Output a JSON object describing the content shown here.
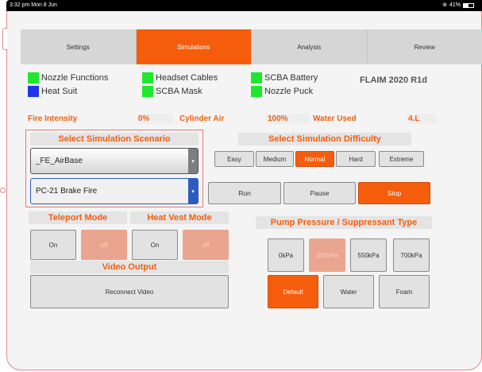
{
  "status_bar": {
    "time": "3:32 pm  Mon 8 Jun",
    "battery": "41%"
  },
  "tabs": [
    {
      "label": "Settings",
      "active": false
    },
    {
      "label": "Simulations",
      "active": true
    },
    {
      "label": "Analysis",
      "active": false
    },
    {
      "label": "Review",
      "active": false
    }
  ],
  "equipment": [
    {
      "label": "Nozzle Functions",
      "color": "#1ee82d"
    },
    {
      "label": "Heat Suit",
      "color": "#1e37e8"
    },
    {
      "label": "Headset Cables",
      "color": "#1ee82d"
    },
    {
      "label": "SCBA Mask",
      "color": "#1ee82d"
    },
    {
      "label": "SCBA Battery",
      "color": "#1ee82d"
    },
    {
      "label": "Nozzle Puck",
      "color": "#1ee82d"
    }
  ],
  "firmware": "FLAIM 2020 R1d",
  "metrics": {
    "fire_intensity_label": "Fire Intensity",
    "fire_intensity_value": "0%",
    "cylinder_air_label": "Cylinder Air",
    "cylinder_air_value": "100%",
    "water_used_label": "Water Used",
    "water_used_value": "4.L"
  },
  "scenario": {
    "title": "Select Simulation Scenario",
    "base_value": "_FE_AirBase",
    "scenario_value": "PC-21 Brake Fire"
  },
  "difficulty": {
    "title": "Select Simulation Difficulty",
    "options": [
      "Easy",
      "Medium",
      "Normal",
      "Hard",
      "Extreme"
    ],
    "selected": "Normal"
  },
  "controls": {
    "run": "Run",
    "pause": "Pause",
    "stop": "Stop"
  },
  "teleport": {
    "title": "Teleport Mode",
    "on": "On",
    "off": "off"
  },
  "heat_vest": {
    "title": "Heat Vest Mode",
    "on": "On",
    "off": "off"
  },
  "video": {
    "title": "Video Output",
    "reconnect": "Reconnect Video"
  },
  "pump": {
    "title": "Pump Pressure / Suppressant Type",
    "pressures": [
      "0kPa",
      "300kPa",
      "550kPa",
      "700kPa"
    ],
    "selected_pressure": "300kPa",
    "suppressants": [
      "Default",
      "Water",
      "Foam"
    ],
    "selected_suppressant": "Default"
  },
  "colors": {
    "accent": "#f55d0d",
    "status_ok": "#1ee82d",
    "status_info": "#1e37e8"
  }
}
